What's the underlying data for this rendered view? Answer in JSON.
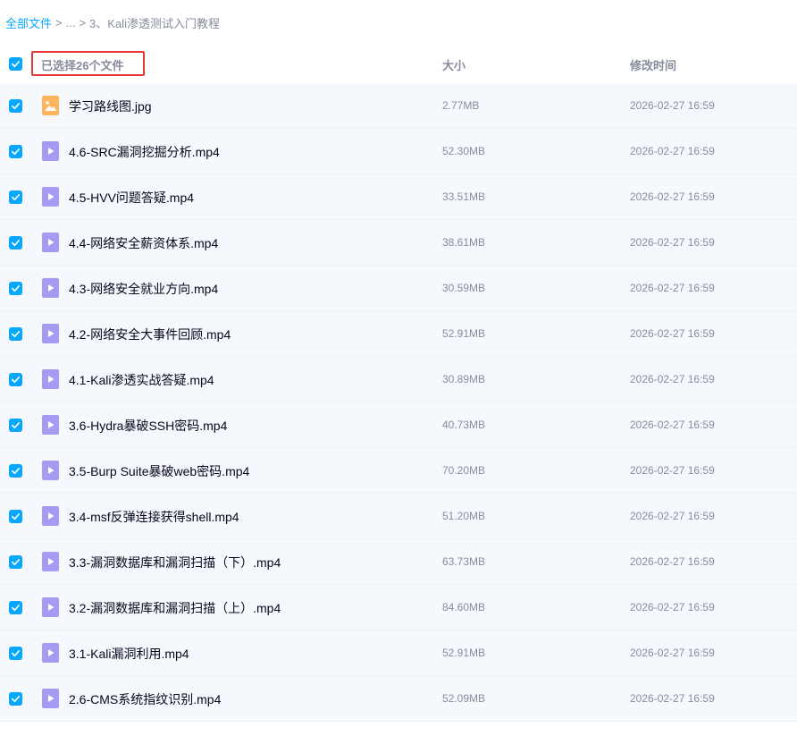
{
  "breadcrumb": {
    "root": "全部文件",
    "ellipsis": "...",
    "current": "3、Kali渗透测试入门教程",
    "sep": ">"
  },
  "header": {
    "selected_text": "已选择26个文件",
    "col_size": "大小",
    "col_time": "修改时间"
  },
  "colors": {
    "accent": "#06a7ff",
    "highlight_box": "#e53935",
    "video_icon": "#a49bf2",
    "image_icon": "#ffb55e"
  },
  "files": [
    {
      "name": "学习路线图.jpg",
      "size": "2.77MB",
      "time": "2026-02-27 16:59",
      "icon": "image-file-icon"
    },
    {
      "name": "4.6-SRC漏洞挖掘分析.mp4",
      "size": "52.30MB",
      "time": "2026-02-27 16:59",
      "icon": "video-file-icon"
    },
    {
      "name": "4.5-HVV问题答疑.mp4",
      "size": "33.51MB",
      "time": "2026-02-27 16:59",
      "icon": "video-file-icon"
    },
    {
      "name": "4.4-网络安全薪资体系.mp4",
      "size": "38.61MB",
      "time": "2026-02-27 16:59",
      "icon": "video-file-icon"
    },
    {
      "name": "4.3-网络安全就业方向.mp4",
      "size": "30.59MB",
      "time": "2026-02-27 16:59",
      "icon": "video-file-icon"
    },
    {
      "name": "4.2-网络安全大事件回顾.mp4",
      "size": "52.91MB",
      "time": "2026-02-27 16:59",
      "icon": "video-file-icon"
    },
    {
      "name": "4.1-Kali渗透实战答疑.mp4",
      "size": "30.89MB",
      "time": "2026-02-27 16:59",
      "icon": "video-file-icon"
    },
    {
      "name": "3.6-Hydra暴破SSH密码.mp4",
      "size": "40.73MB",
      "time": "2026-02-27 16:59",
      "icon": "video-file-icon"
    },
    {
      "name": "3.5-Burp Suite暴破web密码.mp4",
      "size": "70.20MB",
      "time": "2026-02-27 16:59",
      "icon": "video-file-icon"
    },
    {
      "name": "3.4-msf反弹连接获得shell.mp4",
      "size": "51.20MB",
      "time": "2026-02-27 16:59",
      "icon": "video-file-icon"
    },
    {
      "name": "3.3-漏洞数据库和漏洞扫描（下）.mp4",
      "size": "63.73MB",
      "time": "2026-02-27 16:59",
      "icon": "video-file-icon"
    },
    {
      "name": "3.2-漏洞数据库和漏洞扫描（上）.mp4",
      "size": "84.60MB",
      "time": "2026-02-27 16:59",
      "icon": "video-file-icon"
    },
    {
      "name": "3.1-Kali漏洞利用.mp4",
      "size": "52.91MB",
      "time": "2026-02-27 16:59",
      "icon": "video-file-icon"
    },
    {
      "name": "2.6-CMS系统指纹识别.mp4",
      "size": "52.09MB",
      "time": "2026-02-27 16:59",
      "icon": "video-file-icon"
    }
  ]
}
